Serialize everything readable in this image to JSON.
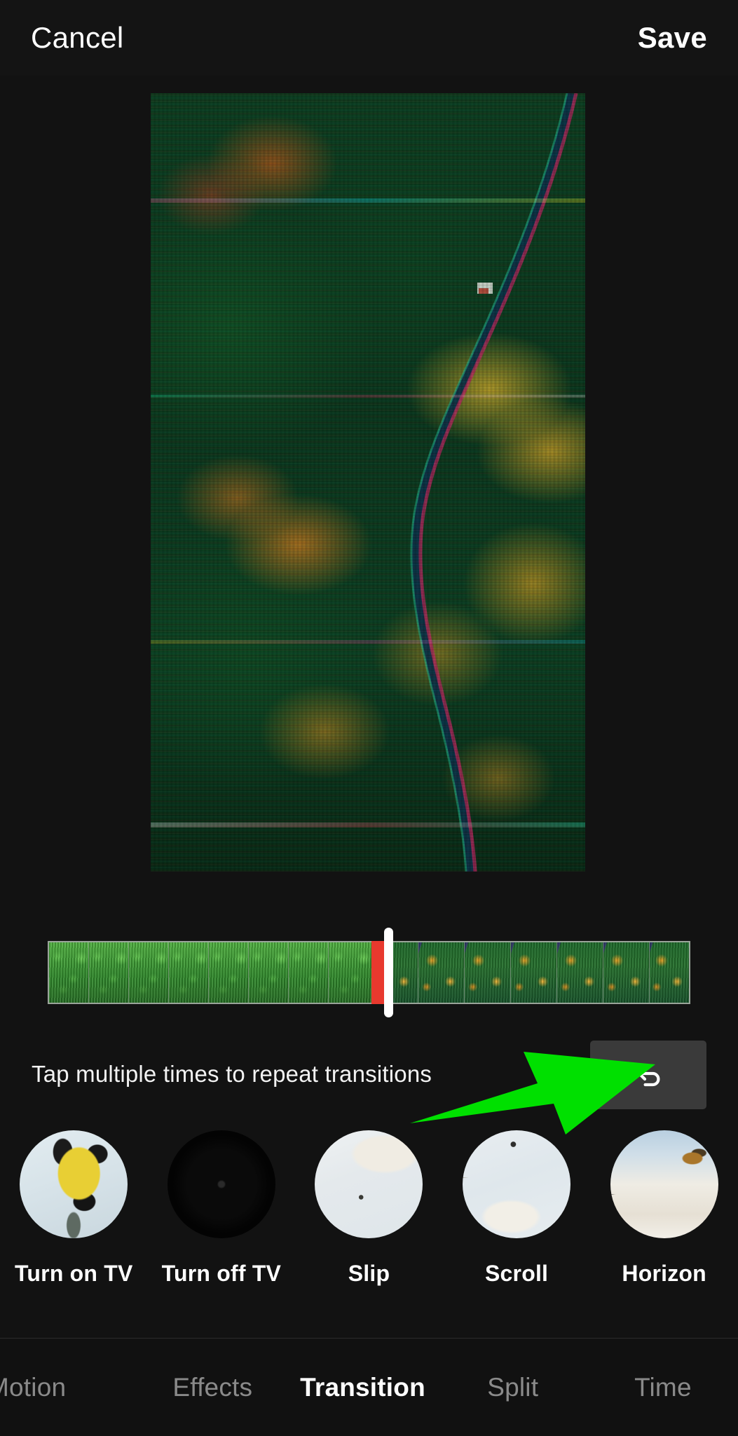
{
  "header": {
    "cancel_label": "Cancel",
    "save_label": "Save"
  },
  "preview": {
    "name": "video-preview-frame",
    "description": "Aerial drone shot of forest road with green and autumn trees, glitch/chroma distortion effect"
  },
  "timeline": {
    "left_clip_description": "green summer forest frames",
    "right_clip_description": "autumn orange forest frames",
    "transition_marker_color": "#e8392e",
    "playhead_color": "#ffffff",
    "left_frames": 8,
    "right_frames": 7
  },
  "hint": {
    "text": "Tap multiple times to repeat transitions"
  },
  "undo": {
    "label": "Undo",
    "icon": "undo-arrow-icon",
    "background": "#3a3a3a"
  },
  "annotation": {
    "arrow_color": "#00e000",
    "points_to": "undo-button"
  },
  "transitions": {
    "items": [
      {
        "label": "Turn on TV",
        "thumb_class": "thumb-turnon",
        "selected": false
      },
      {
        "label": "Turn off TV",
        "thumb_class": "thumb-turnoff",
        "selected": false
      },
      {
        "label": "Slip",
        "thumb_class": "thumb-slip",
        "selected": false
      },
      {
        "label": "Scroll",
        "thumb_class": "thumb-scroll",
        "selected": false
      },
      {
        "label": "Horizon",
        "thumb_class": "thumb-horizon",
        "selected": false
      }
    ]
  },
  "tabs": {
    "items": [
      {
        "label": "Motion",
        "active": false
      },
      {
        "label": "Effects",
        "active": false
      },
      {
        "label": "Transition",
        "active": true
      },
      {
        "label": "Split",
        "active": false
      },
      {
        "label": "Time",
        "active": false
      }
    ]
  },
  "colors": {
    "background": "#121212",
    "topbar": "#141414",
    "tabbar": "#111111",
    "accent_green": "#00e000",
    "marker_red": "#e8392e",
    "active_tab": "#ffffff",
    "inactive_tab": "#8a8a8a"
  }
}
